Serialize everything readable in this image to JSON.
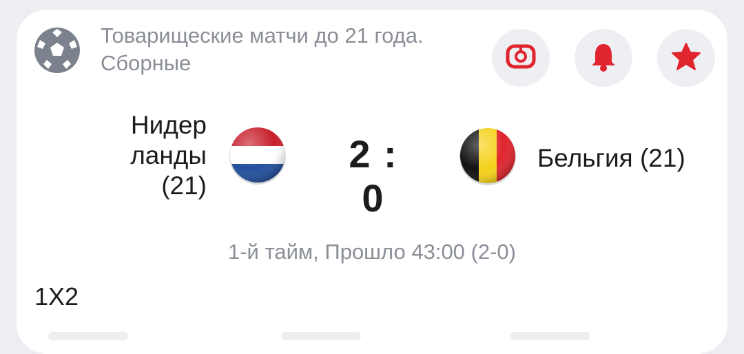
{
  "league": {
    "icon": "soccer-ball-icon",
    "title": "Товарищеские матчи до 21 года. Сборные"
  },
  "actions": {
    "stream_icon": "broadcast-icon",
    "notify_icon": "bell-icon",
    "favorite_icon": "star-icon",
    "accent_color": "#e0252e"
  },
  "match": {
    "home": {
      "name_line1": "Нидер",
      "name_line2": "ланды",
      "name_line3": "(21)",
      "flag": "netherlands-flag-icon"
    },
    "away": {
      "name": "Бельгия (21)",
      "flag": "belgium-flag-icon"
    },
    "score": "2 : 0",
    "status": "1-й тайм, Прошло 43:00 (2-0)"
  },
  "market": {
    "title": "1X2"
  }
}
